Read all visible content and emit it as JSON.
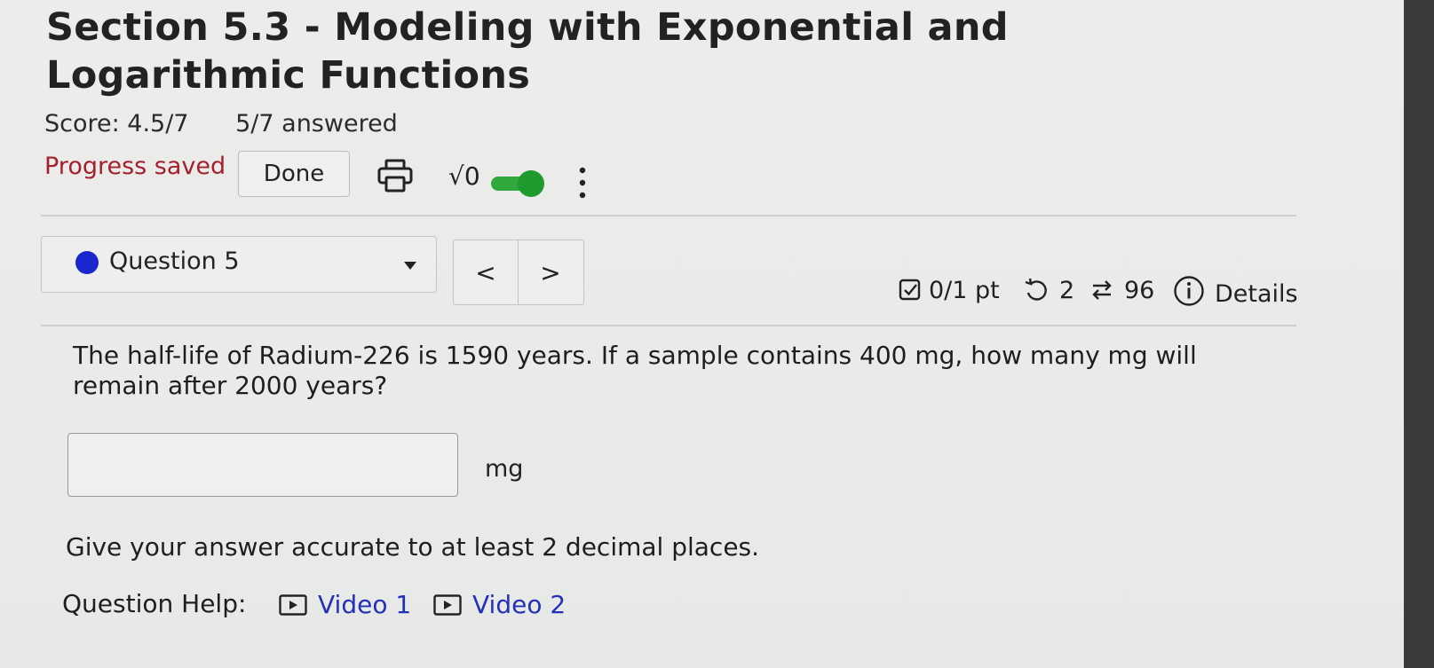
{
  "header": {
    "title": "Section 5.3 - Modeling with Exponential and Logarithmic Functions",
    "score": "Score: 4.5/7",
    "answered": "5/7 answered",
    "progress_status": "Progress saved",
    "done_label": "Done",
    "math_toggle_label": "√0",
    "math_toggle_on": true
  },
  "question_nav": {
    "current_question": "Question 5",
    "prev_label": "<",
    "next_label": ">"
  },
  "question_stats": {
    "points": "0/1 pt",
    "retries": "2",
    "attempts": "96",
    "details_label": "Details"
  },
  "problem": {
    "text": "The half-life of Radium-226 is 1590 years. If a sample contains 400 mg, how many mg will remain after 2000 years?",
    "answer_value": "",
    "unit": "mg",
    "hint": "Give your answer accurate to at least 2 decimal places."
  },
  "help": {
    "label": "Question Help:",
    "videos": [
      {
        "label": "Video 1"
      },
      {
        "label": "Video 2"
      }
    ]
  },
  "icons": {
    "print": "print-icon",
    "more": "more-vertical-icon",
    "points": "checkbox-icon",
    "retry": "retry-icon",
    "attempts": "refresh-arrows-icon",
    "details": "info-icon",
    "video": "video-play-icon"
  },
  "colors": {
    "progress_saved": "#a3202e",
    "question_dot": "#1a27cf",
    "toggle_on": "#1f9a2c",
    "link": "#2331b8"
  }
}
